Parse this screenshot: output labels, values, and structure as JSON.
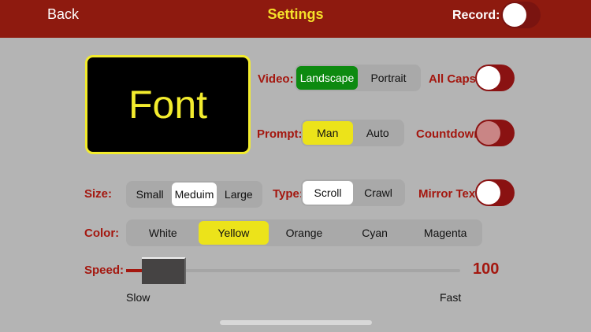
{
  "header": {
    "back": "Back",
    "title": "Settings",
    "record_label": "Record:"
  },
  "preview": {
    "text": "Font"
  },
  "video": {
    "label": "Video:",
    "options": [
      "Landscape",
      "Portrait"
    ],
    "selected": "Landscape"
  },
  "prompt": {
    "label": "Prompt:",
    "options": [
      "Man",
      "Auto"
    ],
    "selected": "Man"
  },
  "all_caps": {
    "label": "All Caps:"
  },
  "countdown": {
    "label": "Countdown:"
  },
  "mirror": {
    "label": "Mirror Text:"
  },
  "size": {
    "label": "Size:",
    "options": [
      "Small",
      "Meduim",
      "Large"
    ],
    "selected": "Meduim"
  },
  "type": {
    "label": "Type:",
    "options": [
      "Scroll",
      "Crawl"
    ],
    "selected": "Scroll"
  },
  "color": {
    "label": "Color:",
    "options": [
      "White",
      "Yellow",
      "Orange",
      "Cyan",
      "Magenta"
    ],
    "selected": "Yellow"
  },
  "speed": {
    "label": "Speed:",
    "value": "100",
    "min_label": "Slow",
    "max_label": "Fast"
  }
}
